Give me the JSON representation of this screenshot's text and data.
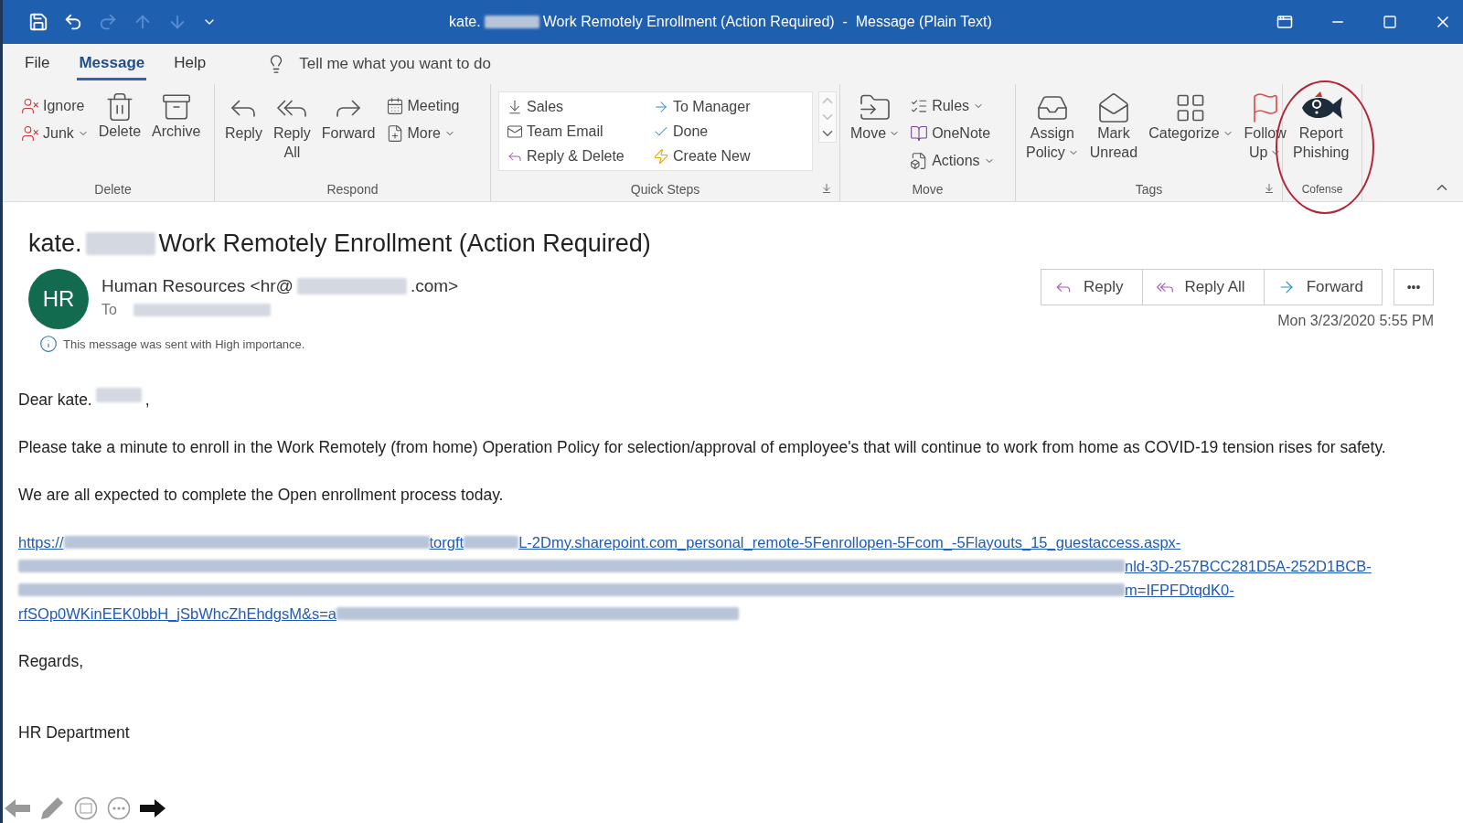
{
  "window": {
    "title_parts": [
      {
        "kind": "text",
        "text": "kate."
      },
      {
        "kind": "redacted"
      },
      {
        "kind": "text",
        "text": "Work Remotely Enrollment (Action Required)  -  Message (Plain Text)"
      }
    ]
  },
  "menu_tabs": [
    {
      "label": "File",
      "selected": false
    },
    {
      "label": "Message",
      "selected": true
    },
    {
      "label": "Help",
      "selected": false
    }
  ],
  "tell_me": {
    "placeholder": "Tell me what you want to do"
  },
  "ribbon": {
    "groups": [
      {
        "label": "Delete",
        "launcher": false,
        "items": [
          {
            "kind": "stack",
            "items": [
              {
                "label": "Ignore",
                "dropdown": false
              },
              {
                "label": "Junk",
                "dropdown": true
              }
            ]
          },
          {
            "kind": "large",
            "lines": [
              "Delete"
            ],
            "dropdown": false
          },
          {
            "kind": "large",
            "lines": [
              "Archive"
            ],
            "dropdown": false
          }
        ]
      },
      {
        "label": "Respond",
        "launcher": false,
        "items": [
          {
            "kind": "large",
            "lines": [
              "Reply"
            ],
            "dropdown": false
          },
          {
            "kind": "large",
            "lines": [
              "Reply",
              "All"
            ],
            "dropdown": false
          },
          {
            "kind": "large",
            "lines": [
              "Forward"
            ],
            "dropdown": false
          },
          {
            "kind": "stack",
            "items": [
              {
                "label": "Meeting",
                "dropdown": false
              },
              {
                "label": "More",
                "dropdown": true
              }
            ]
          }
        ]
      },
      {
        "label": "Quick Steps",
        "launcher": true,
        "items": [
          {
            "kind": "gallery",
            "items": [
              {
                "label": "Sales"
              },
              {
                "label": "Team Email"
              },
              {
                "label": "Reply & Delete"
              },
              {
                "label": "To Manager"
              },
              {
                "label": "Done"
              },
              {
                "label": "Create New"
              }
            ]
          }
        ]
      },
      {
        "label": "Move",
        "launcher": false,
        "items": [
          {
            "kind": "large",
            "lines": [
              "Move"
            ],
            "dropdown": true
          },
          {
            "kind": "stack",
            "items": [
              {
                "label": "Rules",
                "dropdown": true
              },
              {
                "label": "OneNote",
                "dropdown": false
              },
              {
                "label": "Actions",
                "dropdown": true
              }
            ]
          }
        ]
      },
      {
        "label": "Tags",
        "launcher": true,
        "items": [
          {
            "kind": "large",
            "lines": [
              "Assign",
              "Policy"
            ],
            "dropdown": true
          },
          {
            "kind": "large",
            "lines": [
              "Mark",
              "Unread"
            ],
            "dropdown": false
          },
          {
            "kind": "large",
            "lines": [
              "Categorize"
            ],
            "dropdown": true
          },
          {
            "kind": "large",
            "lines": [
              "Follow",
              "Up"
            ],
            "dropdown": true
          }
        ]
      },
      {
        "label": "Cofense",
        "launcher": false,
        "highlighted": true,
        "items": [
          {
            "kind": "large",
            "lines": [
              "Report",
              "Phishing"
            ],
            "dropdown": false
          }
        ]
      }
    ]
  },
  "message": {
    "subject_parts": [
      {
        "kind": "text",
        "text": "kate."
      },
      {
        "kind": "redacted"
      },
      {
        "kind": "text",
        "text": "Work Remotely Enrollment (Action Required)"
      }
    ],
    "avatar": "HR",
    "sender_parts": [
      {
        "kind": "text",
        "text": "Human Resources <hr@"
      },
      {
        "kind": "redacted"
      },
      {
        "kind": "text",
        "text": ".com>"
      }
    ],
    "to_label": "To",
    "actions": [
      "Reply",
      "Reply All",
      "Forward"
    ],
    "more": "•••",
    "date": "Mon 3/23/2020 5:55 PM",
    "importance": "This message was sent with High importance.",
    "body": {
      "greeting_parts": [
        {
          "kind": "text",
          "text": "Dear kate."
        },
        {
          "kind": "redacted"
        },
        {
          "kind": "text",
          "text": ","
        }
      ],
      "paragraphs": [
        "Please take a minute to enroll in the Work Remotely (from home) Operation Policy for selection/approval of employee's that will continue to work from home as COVID-19 tension rises for safety.",
        "We are all expected to complete the Open enrollment process today."
      ],
      "link_lines": [
        [
          {
            "kind": "text",
            "text": "https://"
          },
          {
            "kind": "redacted"
          },
          {
            "kind": "text",
            "text": "torgft"
          },
          {
            "kind": "redacted"
          },
          {
            "kind": "text",
            "text": "L-2Dmy.sharepoint.com_personal_remote-5Fenrollopen-5Fcom_-5Flayouts_15_guestaccess.aspx-"
          }
        ],
        [
          {
            "kind": "redacted"
          },
          {
            "kind": "text",
            "text": "nld-3D-257BCC281D5A-252D1BCB-"
          }
        ],
        [
          {
            "kind": "redacted"
          },
          {
            "kind": "text",
            "text": "m=IFPFDtqdK0-"
          }
        ],
        [
          {
            "kind": "text",
            "text": "rfSOp0WKinEEK0bbH_jSbWhcZhEhdgsM&s=a"
          },
          {
            "kind": "redacted"
          }
        ]
      ],
      "closing": "Regards,",
      "signature": "HR Department"
    }
  }
}
